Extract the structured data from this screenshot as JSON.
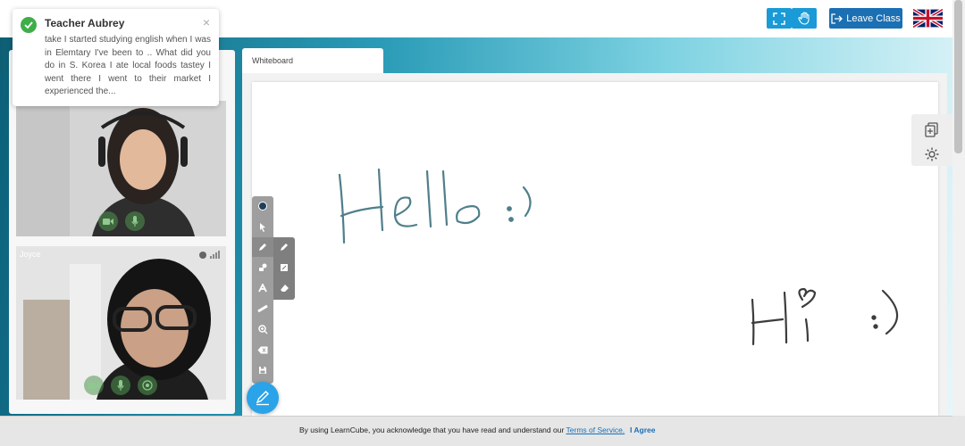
{
  "topbar": {
    "leave_label": "Leave Class",
    "fullscreen_icon": "fullscreen-icon",
    "hand_icon": "raise-hand-icon",
    "language": "en-GB"
  },
  "notification": {
    "title": "Teacher Aubrey",
    "message": "take I started studying english when I was in Elemtary I've been to .. What did you do in S. Korea I ate local foods tastey I went there I went to their market I experienced the...",
    "close_symbol": "×"
  },
  "videos": [
    {
      "name": ""
    },
    {
      "name": "Joyce"
    }
  ],
  "whiteboard": {
    "tab_label": "Whiteboard",
    "strokes": [
      "Hello :)",
      "Hi :)"
    ],
    "ink_color": "#4f7f8a"
  },
  "toolbar": {
    "tools": [
      "color-dot",
      "select",
      "pencil",
      "shapes",
      "text",
      "line",
      "zoom",
      "clear",
      "save"
    ],
    "subtools": [
      "pencil",
      "square",
      "eraser"
    ]
  },
  "cookie": {
    "text": "By using LearnCube, you acknowledge that you have read and understand our",
    "link": "Terms of Service.",
    "agree": "I Agree"
  },
  "colors": {
    "primary": "#1a9ad6",
    "leave": "#1b6fb3",
    "fab": "#2aa3e8",
    "success": "#3fae49"
  }
}
